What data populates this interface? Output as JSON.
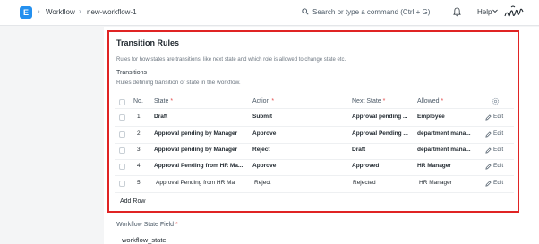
{
  "topbar": {
    "logo_letter": "E",
    "breadcrumbs": [
      "Workflow",
      "new-workflow-1"
    ],
    "breadcrumb_separator": "›",
    "search_placeholder": "Search or type a command (Ctrl + G)",
    "help_label": "Help",
    "icons": [
      "search-icon",
      "bell-icon",
      "chevron-down-icon",
      "signature-avatar"
    ]
  },
  "section": {
    "title": "Transition Rules",
    "description": "Rules for how states are transitions, like next state and which role is allowed to change state etc.",
    "table_label": "Transitions",
    "table_description": "Rules defining transition of state in the workflow.",
    "required_marker": "*"
  },
  "table": {
    "columns": [
      {
        "label": "No.",
        "required": false
      },
      {
        "label": "State",
        "required": true
      },
      {
        "label": "Action",
        "required": true
      },
      {
        "label": "Next State",
        "required": true
      },
      {
        "label": "Allowed",
        "required": true
      }
    ],
    "rows": [
      {
        "no": "1",
        "state": "Draft",
        "action": "Submit",
        "next_state": "Approval pending ...",
        "allowed": "Employee",
        "bold": true
      },
      {
        "no": "2",
        "state": "Approval pending by Manager",
        "action": "Approve",
        "next_state": "Approval Pending ...",
        "allowed": "department mana...",
        "bold": true
      },
      {
        "no": "3",
        "state": "Approval pending by Manager",
        "action": "Reject",
        "next_state": "Draft",
        "allowed": "department mana...",
        "bold": true
      },
      {
        "no": "4",
        "state": "Approval Pending from HR Ma...",
        "action": "Approve",
        "next_state": "Approved",
        "allowed": "HR Manager",
        "bold": true
      },
      {
        "no": "5",
        "state": "Approval Pending from HR Ma",
        "action": "Reject",
        "next_state": "Rejected",
        "allowed": "HR Manager",
        "bold": false
      }
    ],
    "edit_label": "Edit",
    "add_row_label": "Add Row"
  },
  "field": {
    "label": "Workflow State Field",
    "required_marker": "*",
    "value": "workflow_state"
  },
  "colors": {
    "accent": "#2490ef",
    "highlight_border": "#e02424",
    "required": "#e24c4c"
  }
}
